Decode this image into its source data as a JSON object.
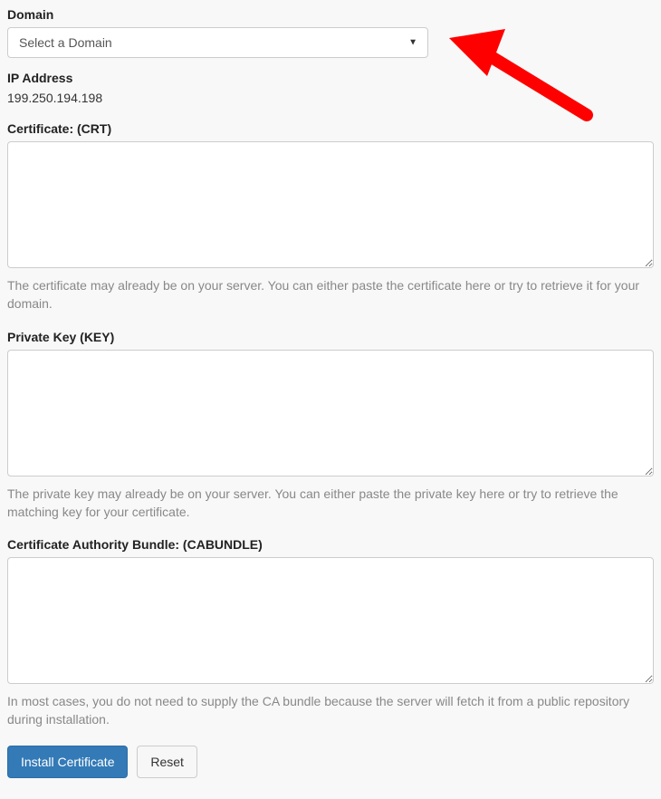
{
  "domain": {
    "label": "Domain",
    "placeholder": "Select a Domain"
  },
  "ip": {
    "label": "IP Address",
    "value": "199.250.194.198"
  },
  "crt": {
    "label": "Certificate: (CRT)",
    "help": "The certificate may already be on your server. You can either paste the certificate here or try to retrieve it for your domain."
  },
  "key": {
    "label": "Private Key (KEY)",
    "help": "The private key may already be on your server. You can either paste the private key here or try to retrieve the matching key for your certificate."
  },
  "cabundle": {
    "label": "Certificate Authority Bundle: (CABUNDLE)",
    "help": "In most cases, you do not need to supply the CA bundle because the server will fetch it from a public repository during installation."
  },
  "buttons": {
    "install": "Install Certificate",
    "reset": "Reset"
  }
}
